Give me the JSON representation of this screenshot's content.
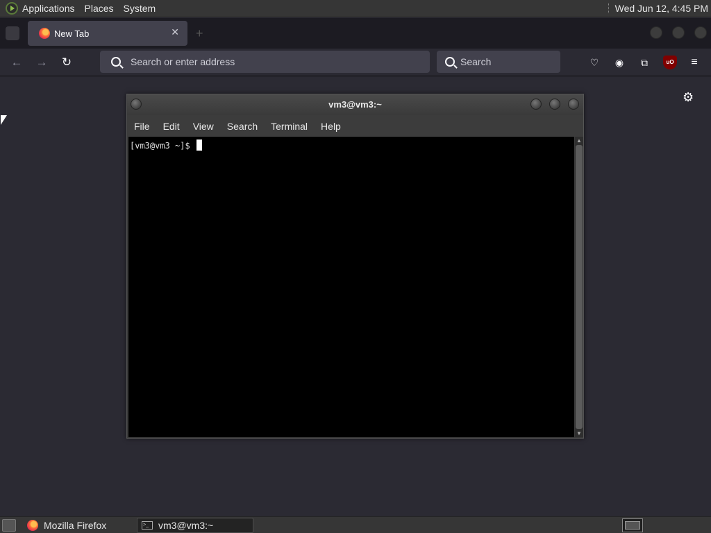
{
  "top_panel": {
    "menus": [
      "Applications",
      "Places",
      "System"
    ],
    "clock": "Wed Jun 12,  4:45 PM"
  },
  "browser": {
    "tab_title": "New Tab",
    "url_placeholder": "Search or enter address",
    "search_placeholder": "Search",
    "ublock_label": "uO"
  },
  "terminal": {
    "title": "vm3@vm3:~",
    "menus": [
      "File",
      "Edit",
      "View",
      "Search",
      "Terminal",
      "Help"
    ],
    "prompt": "[vm3@vm3 ~]$ "
  },
  "taskbar": {
    "tasks": [
      {
        "label": "Mozilla Firefox",
        "icon": "firefox-icon"
      },
      {
        "label": "vm3@vm3:~",
        "icon": "terminal-icon"
      }
    ]
  }
}
